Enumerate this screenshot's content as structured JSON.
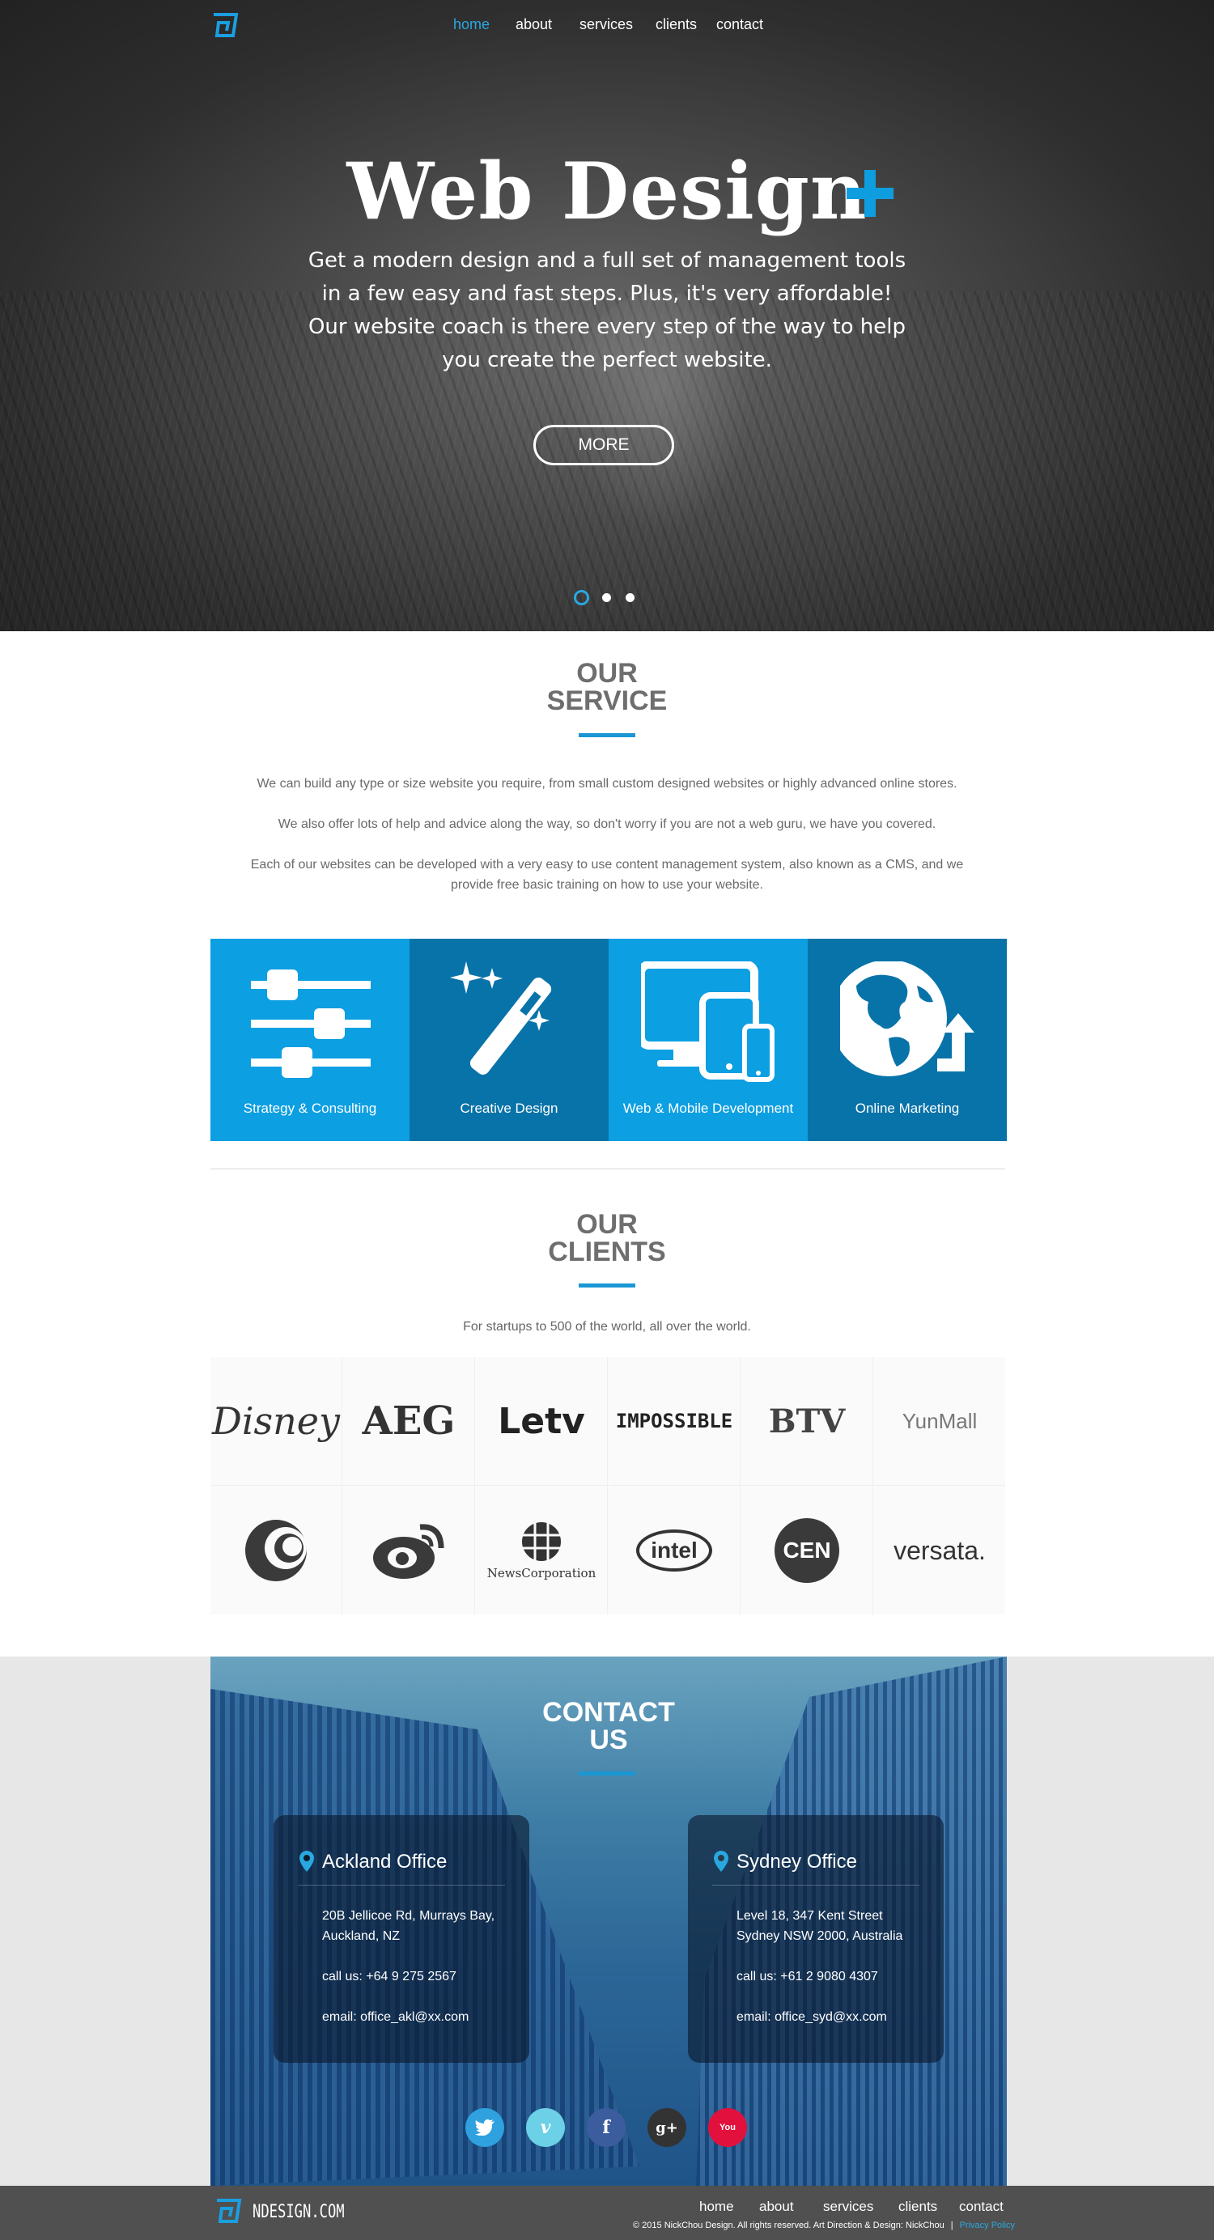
{
  "nav": {
    "items": [
      {
        "label": "home",
        "active": true
      },
      {
        "label": "about",
        "active": false
      },
      {
        "label": "services",
        "active": false
      },
      {
        "label": "clients",
        "active": false
      },
      {
        "label": "contact",
        "active": false
      }
    ]
  },
  "hero": {
    "title": "Web Design",
    "lines": [
      "Get a modern design and a full set of management tools",
      "in a few easy and fast steps. Plus, it's very affordable!",
      "Our website coach is there every step of the way to help",
      "you create the perfect website."
    ],
    "more_label": "MORE",
    "slides": 3,
    "active_slide": 1
  },
  "service": {
    "title_line1": "OUR",
    "title_line2": "SERVICE",
    "paragraphs": [
      "We can build any type or size website you require, from small custom designed websites or highly advanced online stores.",
      "We also offer lots of help and advice along the way, so don't worry if you are not a web guru, we have you covered.",
      "Each of our websites can be developed with a very easy to use content management system, also known as a CMS, and we provide free basic training on how to use your website."
    ],
    "tiles": [
      {
        "label": "Strategy & Consulting",
        "icon": "sliders-icon",
        "color": "#0c9fe2"
      },
      {
        "label": "Creative Design",
        "icon": "magic-wand-icon",
        "color": "#0873a8"
      },
      {
        "label": "Web & Mobile Development",
        "icon": "devices-icon",
        "color": "#0c9fe2"
      },
      {
        "label": "Online Marketing",
        "icon": "globe-growth-icon",
        "color": "#0873a8"
      }
    ]
  },
  "clients": {
    "title_line1": "OUR",
    "title_line2": "CLIENTS",
    "subtitle": "For startups to 500 of the world, all over the world.",
    "logos": [
      {
        "name": "disney-logo",
        "text": "Disney"
      },
      {
        "name": "aeg-logo",
        "text": "AEG"
      },
      {
        "name": "letv-logo",
        "text": "Letv"
      },
      {
        "name": "impossible-logo",
        "text": "IMPOSSIBLE"
      },
      {
        "name": "btv-logo",
        "text": "BTV"
      },
      {
        "name": "yunmall-logo",
        "text": "YunMall"
      },
      {
        "name": "swirl-logo",
        "text": ""
      },
      {
        "name": "weibo-logo",
        "text": ""
      },
      {
        "name": "newscorp-logo",
        "text": "NewsCorporation"
      },
      {
        "name": "intel-logo",
        "text": "intel"
      },
      {
        "name": "cen-logo",
        "text": "CEN"
      },
      {
        "name": "versata-logo",
        "text": "versata."
      }
    ]
  },
  "contact": {
    "title_line1": "CONTACT",
    "title_line2": "US",
    "offices": [
      {
        "name": "Ackland Office",
        "address_line1": "20B Jellicoe Rd, Murrays Bay,",
        "address_line2": "Auckland, NZ",
        "phone": "call us: +64 9 275 2567",
        "email": "email: office_akl@xx.com"
      },
      {
        "name": "Sydney Office",
        "address_line1": "Level 18, 347 Kent Street",
        "address_line2": "Sydney NSW 2000, Australia",
        "phone": "call us: +61 2 9080 4307",
        "email": "email: office_syd@xx.com"
      }
    ],
    "socials": [
      {
        "name": "twitter-icon",
        "glyph": "t",
        "color": "#2fa1de"
      },
      {
        "name": "vimeo-icon",
        "glyph": "v",
        "color": "#6cd0e6"
      },
      {
        "name": "facebook-icon",
        "glyph": "f",
        "color": "#3b5d9e"
      },
      {
        "name": "googleplus-icon",
        "glyph": "g+",
        "color": "#333333"
      },
      {
        "name": "youtube-icon",
        "glyph": "You",
        "color": "#e2103c"
      }
    ]
  },
  "footer": {
    "brand": "NDESIGN.COM",
    "nav": [
      "home",
      "about",
      "services",
      "clients",
      "contact"
    ],
    "copyright": "© 2015 NickChou Design. All rights reserved.  Art Direction & Design: NickChou",
    "separator": "|",
    "privacy": "Privacy Policy"
  }
}
